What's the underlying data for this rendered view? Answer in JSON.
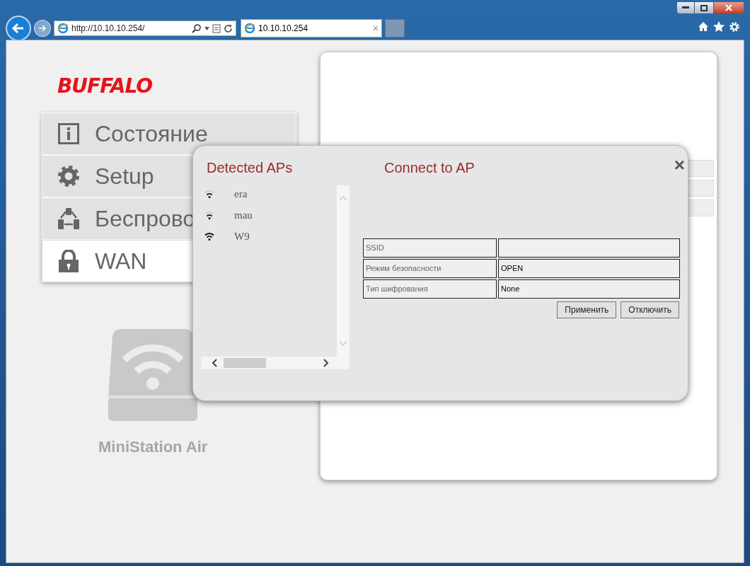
{
  "browser": {
    "address": "http://10.10.10.254/",
    "tabs": [
      {
        "title": "10.10.10.254",
        "selected": true,
        "close": "×"
      }
    ]
  },
  "logo": "BUFFALO",
  "nav": [
    {
      "label": "Состояние",
      "selected": false
    },
    {
      "label": "Setup",
      "selected": false
    },
    {
      "label": "Беспрово",
      "selected": false
    },
    {
      "label": "WAN",
      "selected": true
    }
  ],
  "product": "MiniStation Air",
  "dialog": {
    "close": "×",
    "detected_title": "Detected APs",
    "connect_title": "Connect to AP",
    "aps": [
      {
        "name": "era",
        "kind": "weak"
      },
      {
        "name": "mau",
        "kind": "weak"
      },
      {
        "name": "W9",
        "kind": "full"
      }
    ],
    "fields": [
      {
        "label": "SSID"
      },
      {
        "label": "Режим безопасности",
        "value": "OPEN"
      },
      {
        "label": "Тип шифрования",
        "value": "None"
      }
    ],
    "buttons": [
      "Применить",
      "Отключить"
    ]
  }
}
